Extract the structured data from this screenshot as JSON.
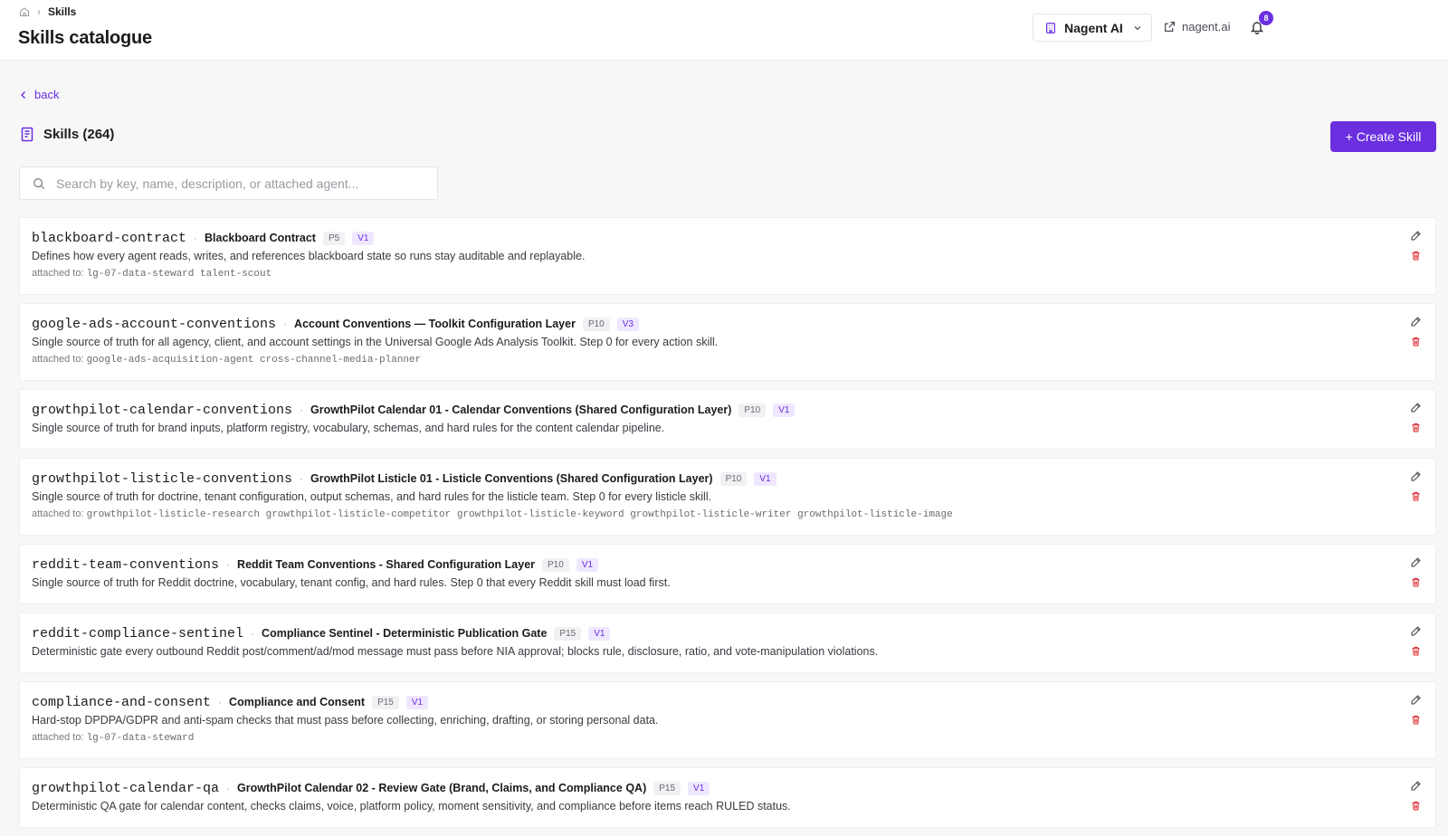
{
  "breadcrumb": {
    "current": "Skills"
  },
  "page_title": "Skills catalogue",
  "header": {
    "org_name": "Nagent AI",
    "external_link": "nagent.ai",
    "notification_count": "8"
  },
  "back_label": "back",
  "section": {
    "title": "Skills (264)"
  },
  "create_button": "+ Create Skill",
  "search": {
    "placeholder": "Search by key, name, description, or attached agent..."
  },
  "attached_prefix": "attached to:",
  "skills": [
    {
      "key": "blackboard-contract",
      "name": "Blackboard Contract",
      "priority": "P5",
      "version": "V1",
      "description": "Defines how every agent reads, writes, and references blackboard state so runs stay auditable and replayable.",
      "attached": "lg-07-data-steward talent-scout"
    },
    {
      "key": "google-ads-account-conventions",
      "name": "Account Conventions — Toolkit Configuration Layer",
      "priority": "P10",
      "version": "V3",
      "description": "Single source of truth for all agency, client, and account settings in the Universal Google Ads Analysis Toolkit. Step 0 for every action skill.",
      "attached": "google-ads-acquisition-agent cross-channel-media-planner"
    },
    {
      "key": "growthpilot-calendar-conventions",
      "name": "GrowthPilot Calendar 01 - Calendar Conventions (Shared Configuration Layer)",
      "priority": "P10",
      "version": "V1",
      "description": "Single source of truth for brand inputs, platform registry, vocabulary, schemas, and hard rules for the content calendar pipeline.",
      "attached": null
    },
    {
      "key": "growthpilot-listicle-conventions",
      "name": "GrowthPilot Listicle 01 - Listicle Conventions (Shared Configuration Layer)",
      "priority": "P10",
      "version": "V1",
      "description": "Single source of truth for doctrine, tenant configuration, output schemas, and hard rules for the listicle team. Step 0 for every listicle skill.",
      "attached": "growthpilot-listicle-research growthpilot-listicle-competitor growthpilot-listicle-keyword growthpilot-listicle-writer growthpilot-listicle-image"
    },
    {
      "key": "reddit-team-conventions",
      "name": "Reddit Team Conventions - Shared Configuration Layer",
      "priority": "P10",
      "version": "V1",
      "description": "Single source of truth for Reddit doctrine, vocabulary, tenant config, and hard rules. Step 0 that every Reddit skill must load first.",
      "attached": null
    },
    {
      "key": "reddit-compliance-sentinel",
      "name": "Compliance Sentinel - Deterministic Publication Gate",
      "priority": "P15",
      "version": "V1",
      "description": "Deterministic gate every outbound Reddit post/comment/ad/mod message must pass before NIA approval; blocks rule, disclosure, ratio, and vote-manipulation violations.",
      "attached": null
    },
    {
      "key": "compliance-and-consent",
      "name": "Compliance and Consent",
      "priority": "P15",
      "version": "V1",
      "description": "Hard-stop DPDPA/GDPR and anti-spam checks that must pass before collecting, enriching, drafting, or storing personal data.",
      "attached": "lg-07-data-steward"
    },
    {
      "key": "growthpilot-calendar-qa",
      "name": "GrowthPilot Calendar 02 - Review Gate (Brand, Claims, and Compliance QA)",
      "priority": "P15",
      "version": "V1",
      "description": "Deterministic QA gate for calendar content, checks claims, voice, platform policy, moment sensitivity, and compliance before items reach RULED status.",
      "attached": null
    }
  ]
}
